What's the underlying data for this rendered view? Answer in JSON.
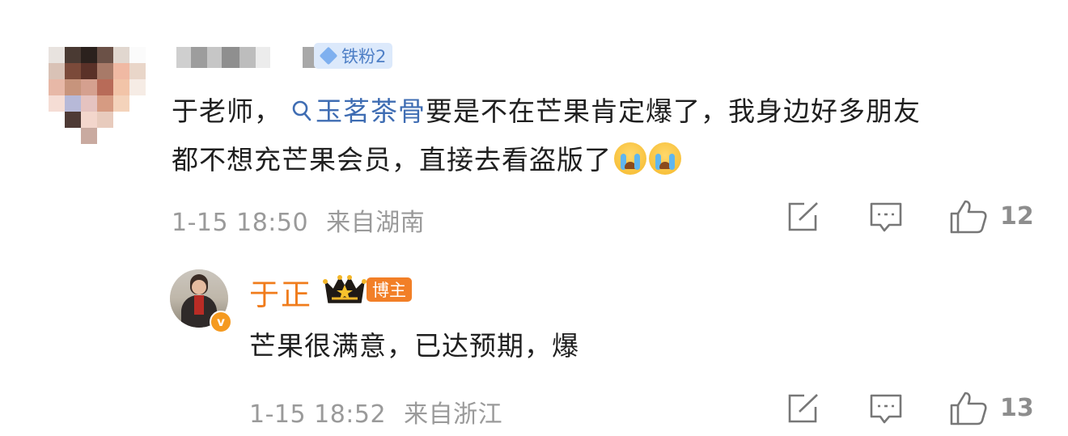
{
  "comment": {
    "badge_label": "铁粉2",
    "text_before": "于老师，",
    "topic_label": "玉茗茶骨",
    "text_after_line1": "要是不在芒果肯定爆了，我身边好多朋友",
    "text_line2": "都不想充芒果会员，直接去看盗版了",
    "emoji_count": 2,
    "date": "1-15 18:50",
    "location": "来自湖南",
    "like_count": "12"
  },
  "reply": {
    "user_name": "于正",
    "badge_label": "博主",
    "text": "芒果很满意，已达预期，爆",
    "date": "1-15 18:52",
    "location": "来自浙江",
    "like_count": "13"
  },
  "icons": {
    "share": "share-edit-icon",
    "comment": "comment-icon",
    "like": "thumbs-up-icon",
    "topic": "search-icon",
    "crown": "crown-icon",
    "verified": "verified-v-icon"
  },
  "colors": {
    "topic_blue": "#3f6db3",
    "blogger_orange": "#f07c1c",
    "meta_gray": "#9a9a9a",
    "fan_badge_bg": "#dce9fb"
  }
}
